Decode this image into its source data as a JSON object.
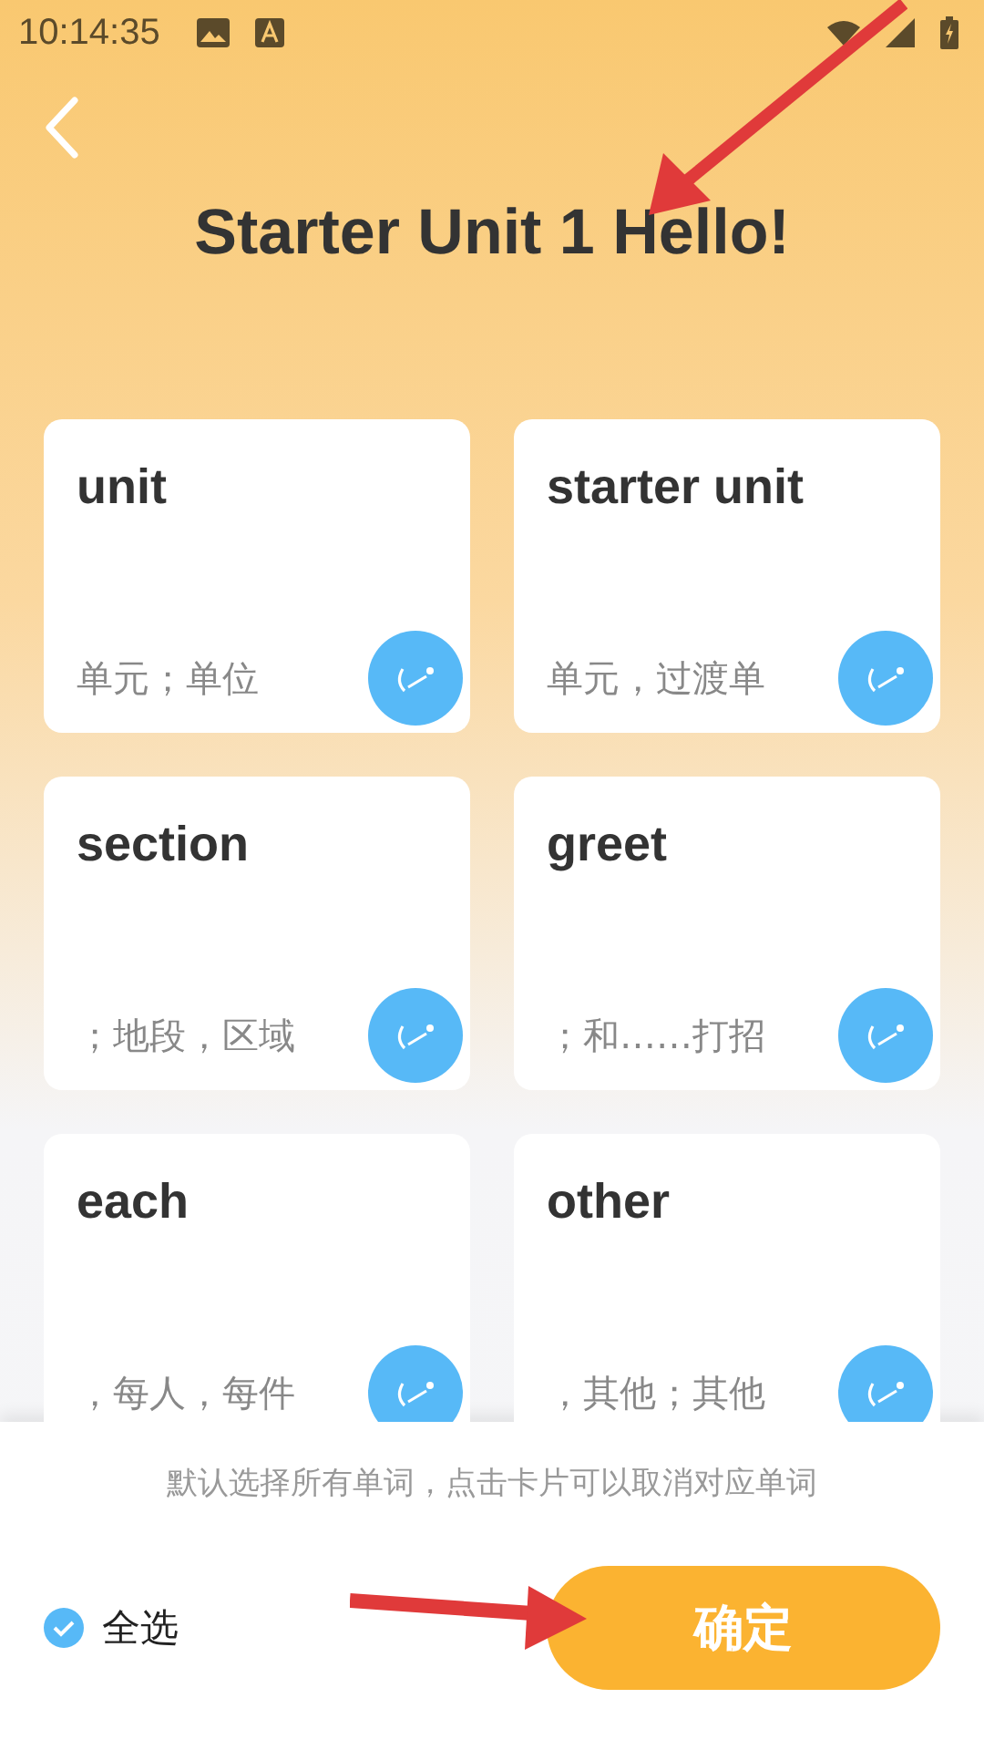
{
  "status_bar": {
    "time": "10:14:35"
  },
  "title": "Starter Unit 1 Hello!",
  "cards": [
    {
      "word": "unit",
      "meaning": "单元；单位",
      "selected": true
    },
    {
      "word": "starter unit",
      "meaning": "单元，过渡单",
      "selected": true
    },
    {
      "word": "section",
      "meaning": "；地段，区域",
      "selected": true
    },
    {
      "word": "greet",
      "meaning": "；和……打招",
      "selected": true
    },
    {
      "word": "each",
      "meaning": "，每人，每件",
      "selected": true
    },
    {
      "word": "other",
      "meaning": "，其他；其他",
      "selected": true
    }
  ],
  "hint": "默认选择所有单词，点击卡片可以取消对应单词",
  "select_all": {
    "label": "全选",
    "checked": true
  },
  "confirm_button": "确定"
}
